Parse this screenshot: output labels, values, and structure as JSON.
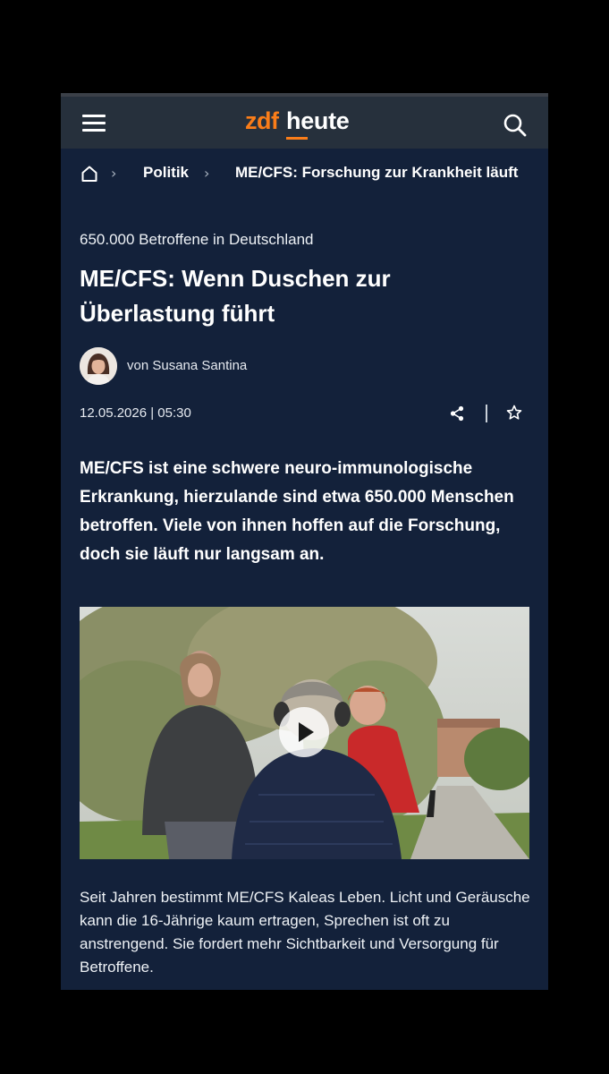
{
  "header": {
    "logo_zdf": "zdf",
    "logo_heute": "heute",
    "menu_icon": "hamburger-menu-icon",
    "search_icon": "search-icon",
    "accent_color": "#fa7d19"
  },
  "breadcrumb": {
    "home_icon": "home-icon",
    "items": [
      {
        "label": "Politik"
      },
      {
        "label": "ME/CFS: Forschung zur Krankheit läuft"
      }
    ]
  },
  "article": {
    "kicker": "650.000 Betroffene in Deutschland",
    "title": "ME/CFS: Wenn Duschen zur Überlastung führt",
    "author": "von Susana Santina",
    "date": "12.05.2026 | 05:30",
    "share_icon": "share-icon",
    "favorite_icon": "star-icon",
    "lead": "ME/CFS ist eine schwere neuro-immunologische Erkrankung, hierzulande sind etwa 650.000 Menschen betroffen. Viele von ihnen hoffen auf die Forschung, doch sie läuft nur langsam an.",
    "video": {
      "play_icon": "play-icon"
    },
    "caption": "Seit Jahren bestimmt ME/CFS Kaleas Leben. Licht und Geräusche kann die 16-Jährige kaum ertragen, Sprechen ist oft zu anstrengend. Sie fordert mehr Sichtbarkeit und Versorgung für Betroffene."
  },
  "colors": {
    "background": "#13213a",
    "header": "#26303c"
  }
}
